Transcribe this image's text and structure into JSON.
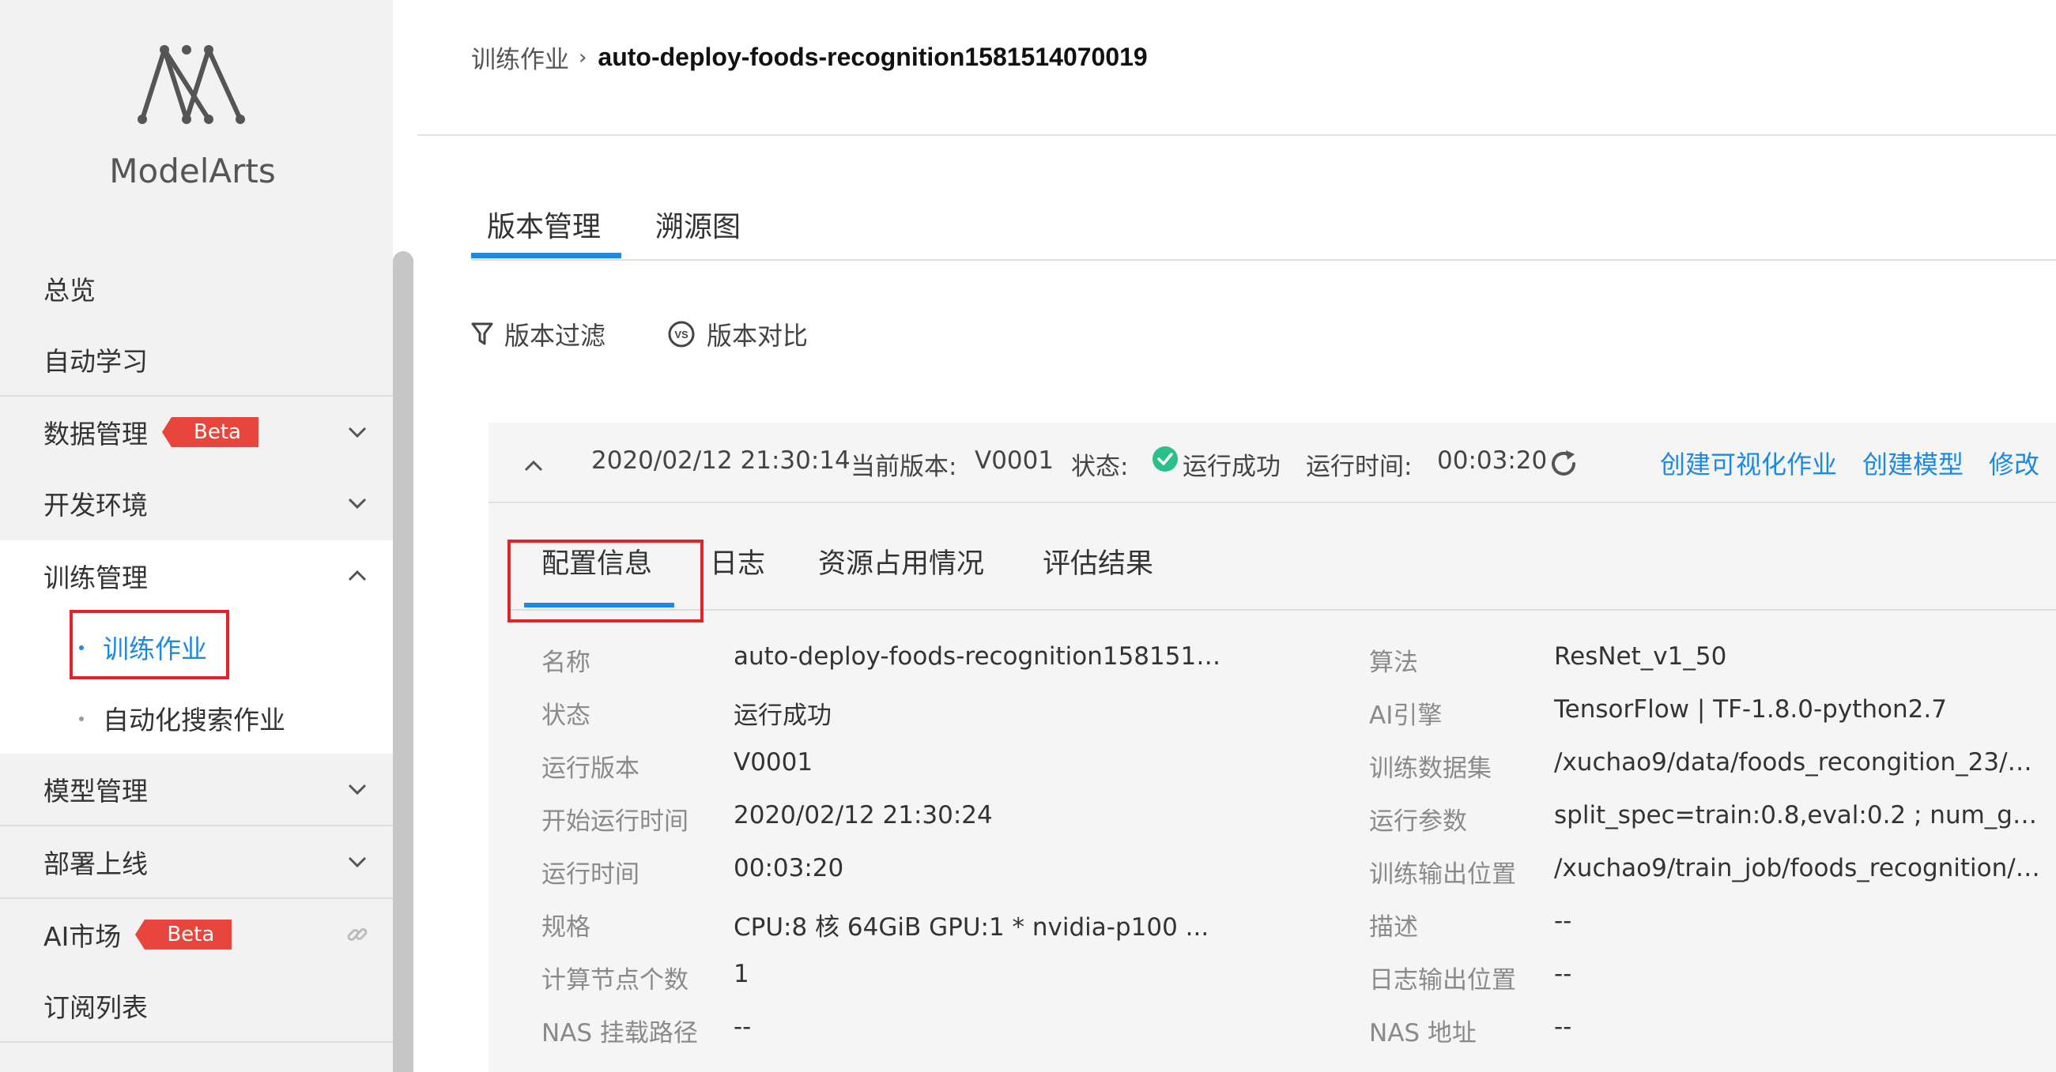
{
  "brand": {
    "name": "ModelArts"
  },
  "sidebar": {
    "items": [
      {
        "label": "总览"
      },
      {
        "label": "自动学习"
      },
      {
        "label": "数据管理",
        "badge": "Beta"
      },
      {
        "label": "开发环境"
      },
      {
        "label": "训练管理"
      },
      {
        "label": "模型管理"
      },
      {
        "label": "部署上线"
      },
      {
        "label": "AI市场",
        "badge": "Beta"
      },
      {
        "label": "订阅列表"
      }
    ],
    "sub_items": [
      {
        "label": "训练作业",
        "active": true
      },
      {
        "label": "自动化搜索作业",
        "active": false
      }
    ]
  },
  "breadcrumb": {
    "parent": "训练作业",
    "separator": "›",
    "current": "auto-deploy-foods-recognition1581514070019"
  },
  "tabs": [
    {
      "label": "版本管理",
      "active": true
    },
    {
      "label": "溯源图",
      "active": false
    }
  ],
  "toolbar": {
    "filter_label": "版本过滤",
    "compare_label": "版本对比",
    "compare_icon_text": "VS"
  },
  "version": {
    "timestamp": "2020/02/12 21:30:14",
    "current_version_label": "当前版本:",
    "current_version": "V0001",
    "status_label": "状态:",
    "status": "运行成功",
    "runtime_label": "运行时间:",
    "runtime": "00:03:20",
    "actions": [
      "创建可视化作业",
      "创建模型",
      "修改"
    ]
  },
  "subtabs": [
    {
      "label": "配置信息",
      "active": true
    },
    {
      "label": "日志"
    },
    {
      "label": "资源占用情况"
    },
    {
      "label": "评估结果"
    }
  ],
  "config_left": [
    {
      "label": "名称",
      "value": "auto-deploy-foods-recognition15815140..."
    },
    {
      "label": "状态",
      "value": "运行成功"
    },
    {
      "label": "运行版本",
      "value": "V0001"
    },
    {
      "label": "开始运行时间",
      "value": "2020/02/12 21:30:24"
    },
    {
      "label": "运行时间",
      "value": "00:03:20"
    },
    {
      "label": "规格",
      "value": "CPU:8 核 64GiB GPU:1 * nvidia-p100 ..."
    },
    {
      "label": "计算节点个数",
      "value": "1"
    },
    {
      "label": "NAS 挂载路径",
      "value": "--"
    }
  ],
  "config_right": [
    {
      "label": "算法",
      "value": "ResNet_v1_50"
    },
    {
      "label": "AI引擎",
      "value": "TensorFlow | TF-1.8.0-python2.7"
    },
    {
      "label": "训练数据集",
      "value": "/xuchao9/data/foods_recongition_23/ou..."
    },
    {
      "label": "运行参数",
      "value": "split_spec=train:0.8,eval:0.2 ; num_gpus..."
    },
    {
      "label": "训练输出位置",
      "value": "/xuchao9/train_job/foods_recognition/o..."
    },
    {
      "label": "描述",
      "value": "--"
    },
    {
      "label": "日志输出位置",
      "value": "--"
    },
    {
      "label": "NAS 地址",
      "value": "--"
    }
  ],
  "colors": {
    "accent": "#1e88e5",
    "success": "#2bbf8a",
    "badge": "#e8453c",
    "highlight_box": "#e3232c"
  },
  "icons": [
    "modelarts-logo",
    "chevron-down-icon",
    "chevron-up-icon",
    "link-icon",
    "filter-icon",
    "vs-icon",
    "check-circle-icon",
    "refresh-icon",
    "collapse-icon"
  ]
}
